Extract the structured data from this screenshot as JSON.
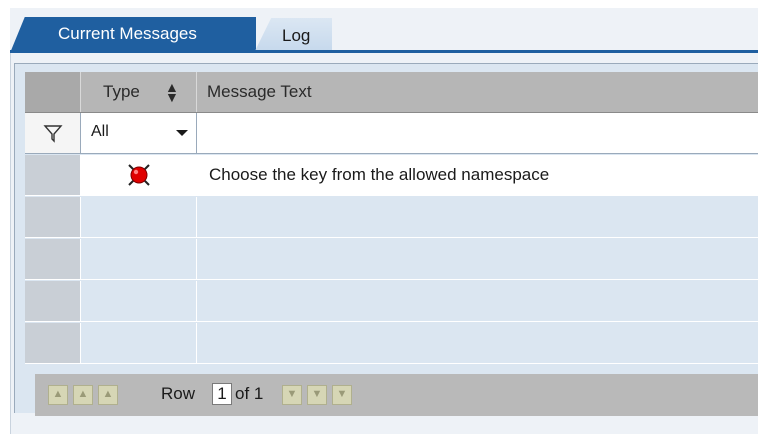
{
  "tabs": {
    "active": "Current Messages",
    "inactive": "Log"
  },
  "table": {
    "columns": [
      "Type",
      "Message Text"
    ],
    "filter": {
      "type_value": "All"
    },
    "rows": [
      {
        "type_icon": "error-red-icon",
        "message": "Choose the key from the allowed namespace"
      },
      {
        "type_icon": "",
        "message": ""
      },
      {
        "type_icon": "",
        "message": ""
      },
      {
        "type_icon": "",
        "message": ""
      },
      {
        "type_icon": "",
        "message": ""
      }
    ]
  },
  "pager": {
    "row_label": "Row",
    "current": "1",
    "of_label": "of 1"
  },
  "colors": {
    "tab_active": "#1f5fa0",
    "error": "#e00000"
  }
}
